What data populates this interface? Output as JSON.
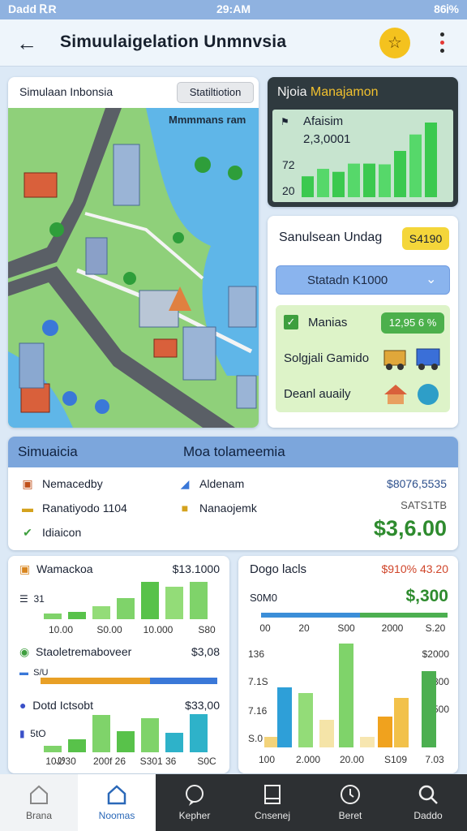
{
  "status_bar": {
    "carrier": "Dadd ᎡR",
    "time": "29:AM",
    "battery": "86Ꭵ%"
  },
  "header": {
    "title": "Simuulaigelation Unmnvsia"
  },
  "map_card": {
    "title": "Simulaan Inbonsia",
    "button": "Statiltiotion",
    "map_label": "Mmmmans ram"
  },
  "stats_card": {
    "title_a": "Njoia ",
    "title_b": "Manajamon",
    "line1": "Afaisim",
    "line2": "2,3,0001",
    "val1": "72",
    "val2": "20",
    "bars": [
      0.28,
      0.38,
      0.34,
      0.45,
      0.45,
      0.44,
      0.62,
      0.84,
      1.0
    ]
  },
  "list_card": {
    "title": "Sanulsean Undag",
    "badge": "S4190",
    "select": "Statadn K1000",
    "rows": [
      {
        "label": "Manias",
        "value": "12,95 6 %"
      },
      {
        "label": "Solgjali Gamido"
      },
      {
        "label": "Deanl auaily"
      }
    ]
  },
  "summary": {
    "header_left": "Simuaicia",
    "header_right": "Moa tolameemia",
    "items": [
      {
        "label": "Nemacedby"
      },
      {
        "label": "Ranatiyodo 1104"
      },
      {
        "label": "Idiaicon"
      },
      {
        "label": "Aldenam"
      },
      {
        "label": "Nanaojemk"
      }
    ],
    "amount1": "$8076,5535",
    "amount2": "SATS1TB",
    "total": "$3,6.00"
  },
  "chart_left": {
    "sections": [
      {
        "label": "Wamackoa",
        "value": "$13.1000",
        "axis_label": "31",
        "ticks": [
          "10.00",
          "S0.00",
          "10.000",
          "S80"
        ],
        "bars": [
          0.15,
          0.18,
          0.32,
          0.52,
          0.93,
          0.81,
          0.93
        ]
      },
      {
        "label": "Staoletremaboveer",
        "value": "$3,08",
        "axis_label": "S/U",
        "progress": 0.62
      },
      {
        "label": "Dotd Ictsobt",
        "value": "$33,00",
        "axis_label": "5tO",
        "ticks": [
          "10Ꮺ30",
          "200f 26",
          "S301 36",
          "S0C"
        ],
        "bars": [
          0.17,
          0.33,
          0.93,
          0.52,
          0.85,
          0.48,
          0.95
        ]
      }
    ]
  },
  "chart_right": {
    "title": "Dogo lacls",
    "badge": "$910% 43.20",
    "total_label": "S0M0",
    "total": "$,300",
    "top_ticks": [
      "00",
      "20",
      "S00",
      "2000",
      "S.20"
    ],
    "y_left": [
      "136",
      "7.1S",
      "7.16",
      "S.0"
    ],
    "y_right": [
      "$2000",
      "$.800",
      "S.500"
    ],
    "x_ticks": [
      "100",
      "2.000",
      "20.00",
      "S109",
      "7.03"
    ],
    "series_bars": [
      0.1,
      0.55,
      0.5,
      0.25,
      0.95,
      0.1,
      0.28,
      0.45,
      0.7
    ]
  },
  "tabs": [
    {
      "label": "Brana",
      "icon": "home-icon"
    },
    {
      "label": "Noomas",
      "icon": "home-icon"
    },
    {
      "label": "Kepher",
      "icon": "chat-icon"
    },
    {
      "label": "Cnsenej",
      "icon": "document-icon"
    },
    {
      "label": "Beret",
      "icon": "clock-icon"
    },
    {
      "label": "Daddo",
      "icon": "search-icon"
    }
  ]
}
